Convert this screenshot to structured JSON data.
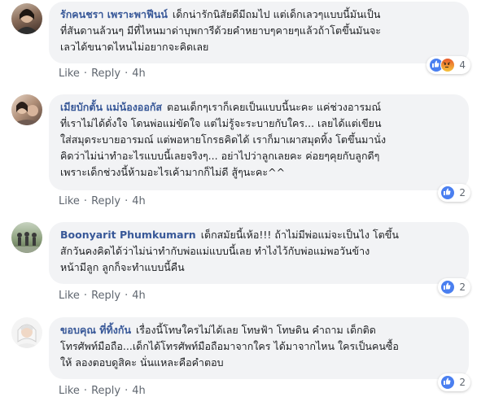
{
  "comments": [
    {
      "author": "รักคนชรา เพราะพาฟีนน์",
      "lines": [
        "เด็กน่ารักนิสัยดีมีถมไป แต่เด็กเลวๆแบบนี้มันเป็น",
        "ที่สันดานล้วนๆ มีที่ไหนมาด่าบุพการีด้วยคำหยาบๆคายๆแล้วถ้าโตขึ้นมันจะ",
        "เลวได้ขนาดไหนไม่อยากจะคิดเลย"
      ],
      "like_label": "Like",
      "reply_label": "Reply",
      "time": "4h",
      "reaction_count": "4",
      "reactions": [
        "like-icon",
        "angry-icon"
      ]
    },
    {
      "author": "เมียบักตั้น แม่น้องออกัส",
      "lines": [
        "ตอนเด็กๆเราก็เคยเป็นแบบนี้นะคะ แค่ช่วงอารมณ์",
        "ที่เราไม่ได้ดั่งใจ โดนพ่อแม่ขัดใจ แต่ไม่รู้จะระบายกับใคร... เลยได้แต่เขียน",
        "ใส่สมุดระบายอารมณ์ แต่พอหายโกรธคิดได้ เราก็มาเผาสมุดทิ้ง โตขึ้นมานั่ง",
        "คิดว่าไม่น่าทำอะไรแบบนี้เลยจริงๆ... อย่าไปว่าลูกเลยคะ ค่อยๆคุยกับลูกดีๆ",
        "เพราะเด็กช่วงนี้ห้ามอะไรเค้ามากก็ไม่ดี สู้ๆนะคะ^^"
      ],
      "like_label": "Like",
      "reply_label": "Reply",
      "time": "4h",
      "reaction_count": "2",
      "reactions": [
        "like-icon"
      ]
    },
    {
      "author": "Boonyarit Phumkumarn",
      "lines": [
        "เด็กสมัยนี้เห้อ!!! ถ้าไม่มีพ่อแม่จะเป็นไง โตขึ้น",
        "สักวันคงคิดได้ว่าไม่น่าทำกับพ่อแม่แบบนี้เลย ทำไงไว้กับพ่อแม่พอวันข้าง",
        "หน้ามีลูก ลูกก็จะทำแบบนี้คืน"
      ],
      "like_label": "Like",
      "reply_label": "Reply",
      "time": "4h",
      "reaction_count": "2",
      "reactions": [
        "like-icon"
      ]
    },
    {
      "author": "ขอบคุณ ที่ทิ้งกัน",
      "lines": [
        "เรื่องนี้โทษใครไม่ได้เลย โทษฟ้า โทษดิน คำถาม เด็กติด",
        "โทรศัพท์มือถือ...เด็กได้โทรศัพท์มือถือมาจากใคร ได้มาจากไหน ใครเป็นคนซื้อ",
        "ให้ ลองตอบดูสิคะ นั่นแหละคือคำตอบ"
      ],
      "like_label": "Like",
      "reply_label": "Reply",
      "time": "4h",
      "reaction_count": "2",
      "reactions": [
        "like-icon"
      ]
    }
  ],
  "separator": "·",
  "colors": {
    "author": "#385898",
    "bubble": "#f2f3f5",
    "meta": "#606770",
    "like": "#4a7ff0"
  }
}
